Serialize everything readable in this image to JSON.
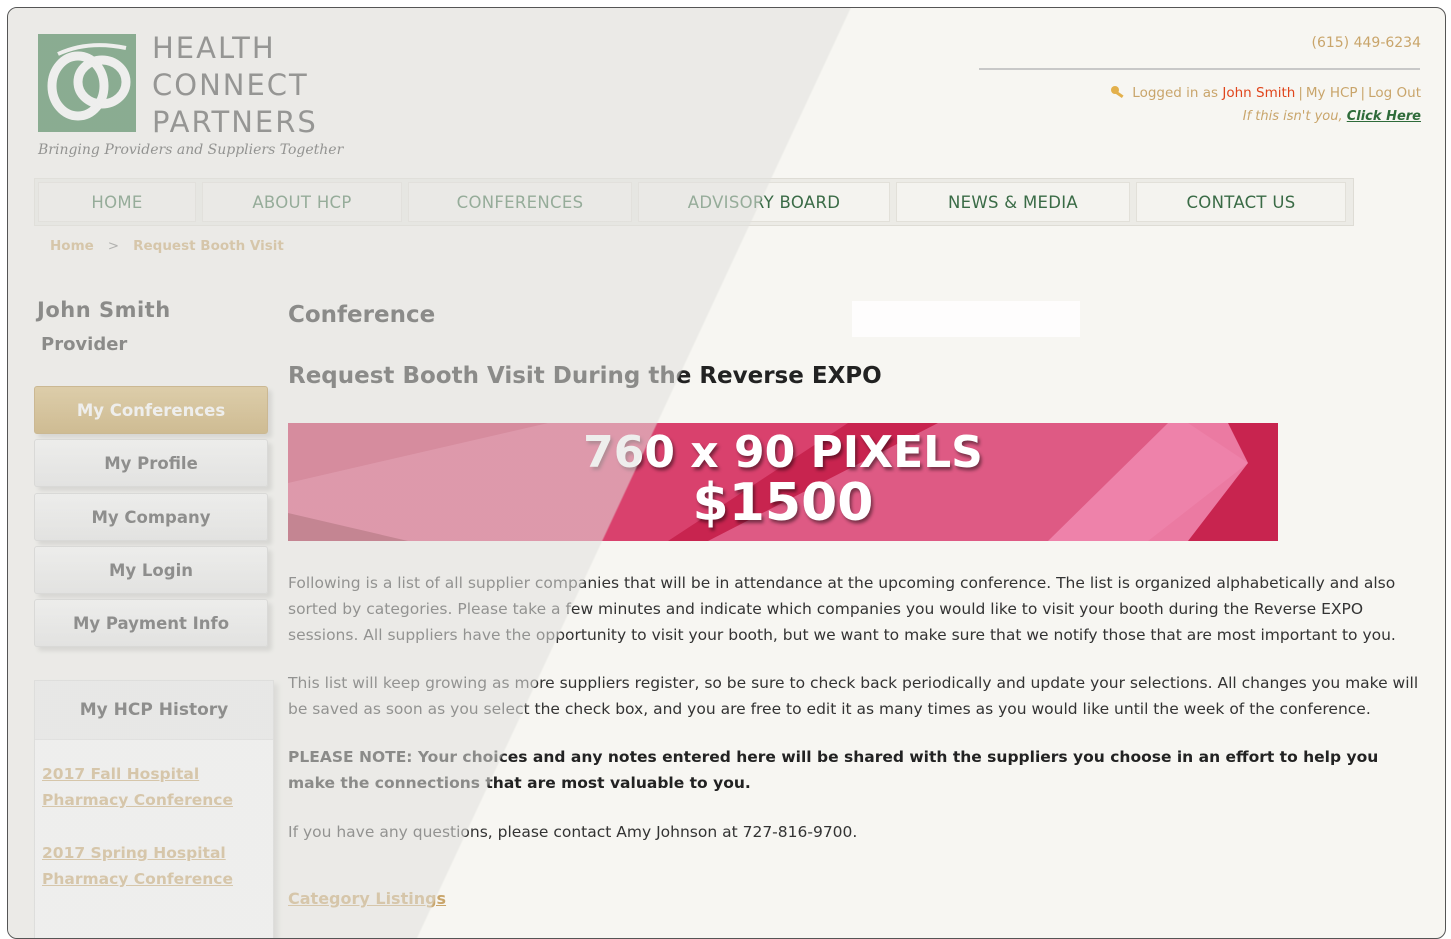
{
  "logo": {
    "lines": [
      "HEALTH",
      "CONNECT",
      "PARTNERS"
    ],
    "tagline": "Bringing Providers and Suppliers Together"
  },
  "header": {
    "phone": "(615) 449-6234",
    "logged_in_prefix": "Logged in as",
    "user_name": "John Smith",
    "my_hcp": "My HCP",
    "log_out": "Log Out",
    "not_you_prefix": "If this isn't you,",
    "click_here": "Click Here"
  },
  "nav": {
    "items": [
      {
        "label": "HOME"
      },
      {
        "label": "ABOUT HCP"
      },
      {
        "label": "CONFERENCES"
      },
      {
        "label": "ADVISORY BOARD"
      },
      {
        "label": "NEWS & MEDIA"
      },
      {
        "label": "CONTACT US"
      }
    ]
  },
  "breadcrumb": {
    "home": "Home",
    "separator": ">",
    "current": "Request Booth Visit"
  },
  "sidebar": {
    "user_name": "John Smith",
    "user_role": "Provider",
    "menu": [
      {
        "label": "My Conferences",
        "active": true
      },
      {
        "label": "My Profile",
        "active": false
      },
      {
        "label": "My Company",
        "active": false
      },
      {
        "label": "My Login",
        "active": false
      },
      {
        "label": "My Payment Info",
        "active": false
      }
    ],
    "history": {
      "title": "My HCP History",
      "links": [
        "2017 Fall Hospital Pharmacy Conference",
        "2017 Spring Hospital Pharmacy Conference"
      ]
    }
  },
  "main": {
    "section_title": "Conference",
    "page_title": "Request Booth Visit During the Reverse EXPO",
    "banner": {
      "line1": "760 x 90 PIXELS",
      "line2": "$1500"
    },
    "paragraphs": [
      "Following is a list of all supplier companies that will be in attendance at the upcoming conference. The list is organized alphabetically and also sorted by categories. Please take a few minutes and indicate which companies you would like to visit your booth during the Reverse EXPO sessions. All suppliers have the opportunity to visit your booth, but we want to make sure that we notify those that are most important to you.",
      "This list will keep growing as more suppliers register, so be sure to check back periodically and update your selections. All changes you make will be saved as soon as you select the check box, and you are free to edit it as many times as you would like until the week of the conference.",
      "PLEASE NOTE: Your choices and any notes entered here will be shared with the suppliers you choose in an effort to help you make the connections that are most valuable to you.",
      "If you have any questions, please contact Amy Johnson at 727-816-9700."
    ],
    "category_link": "Category Listings"
  },
  "colors": {
    "gold": "#c9a56b",
    "green": "#3a6b46",
    "logo_green": "#1f6b34",
    "banner": "#d12e5a"
  }
}
